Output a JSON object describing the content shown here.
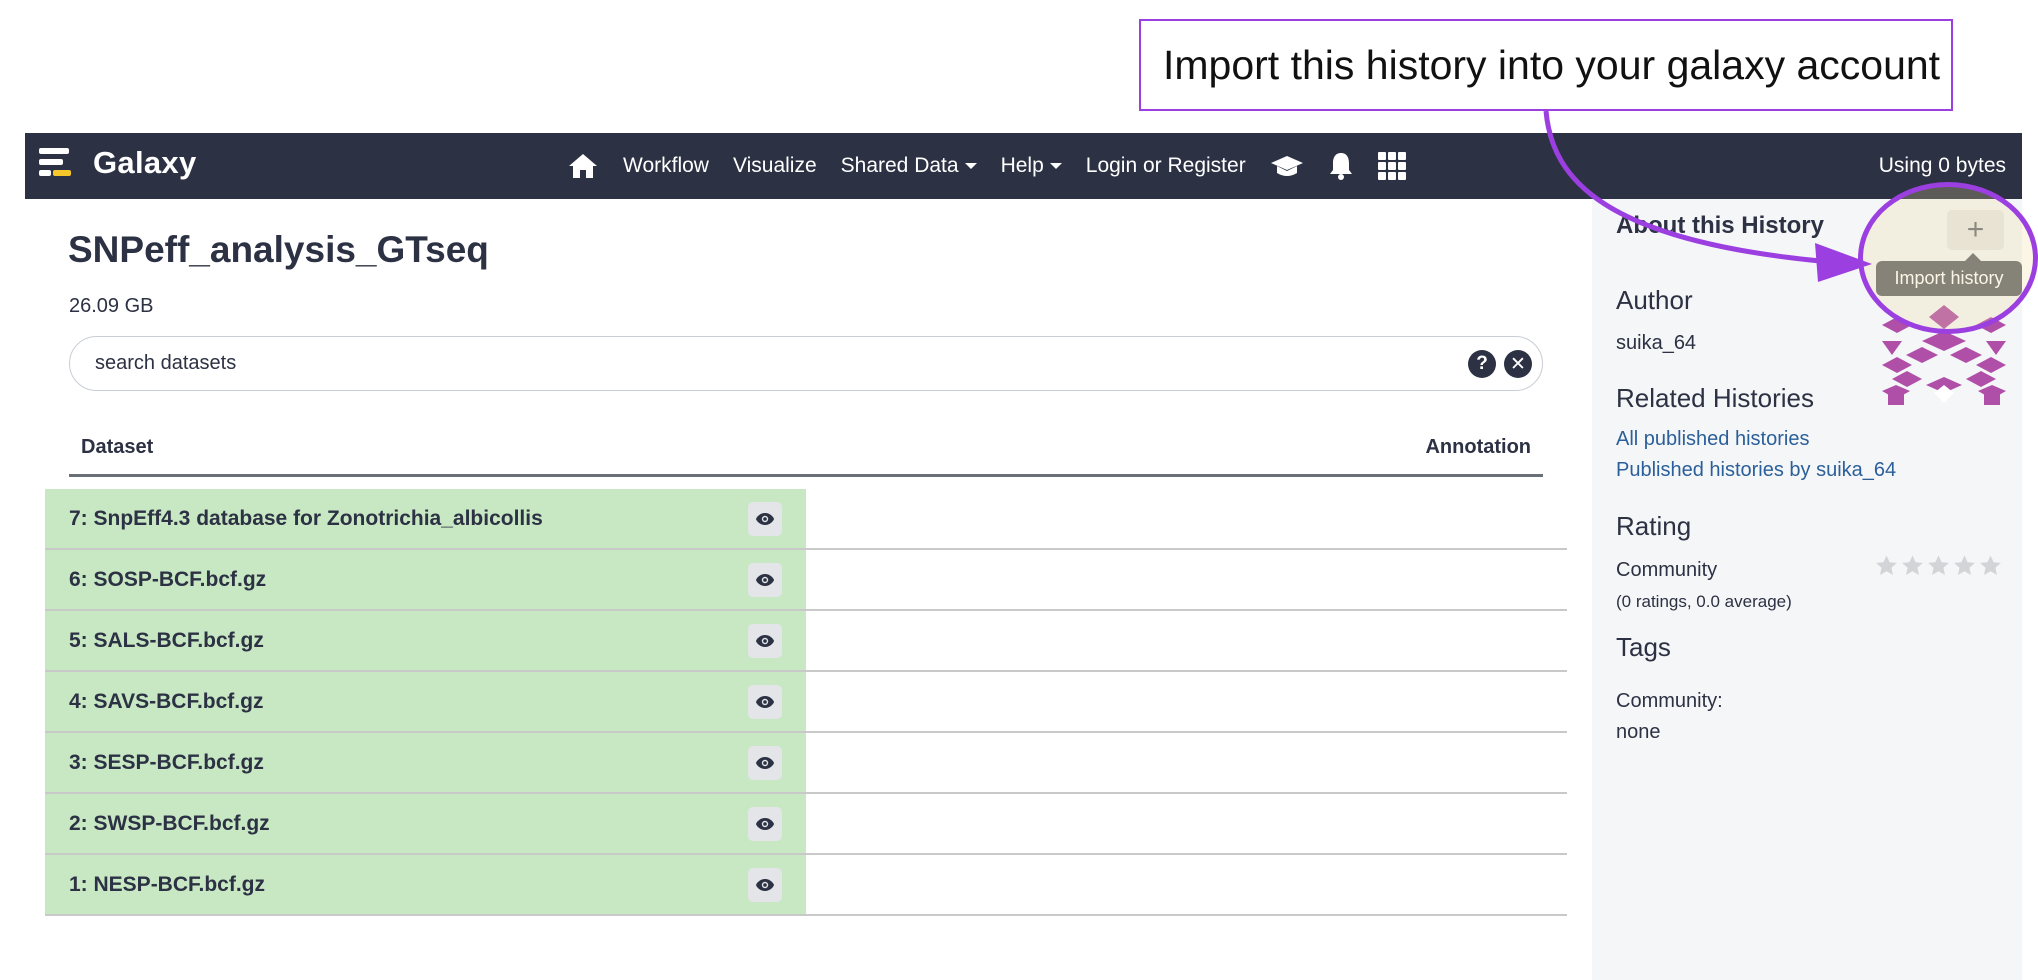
{
  "annotation": {
    "callout_text": "Import this history into your galaxy account",
    "accent_color": "#9b3fe0"
  },
  "navbar": {
    "brand": "Galaxy",
    "items": [
      {
        "label": "Workflow"
      },
      {
        "label": "Visualize"
      },
      {
        "label": "Shared Data"
      },
      {
        "label": "Help"
      },
      {
        "label": "Login or Register"
      }
    ],
    "icons": [
      "home-icon",
      "graduation-cap-icon",
      "bell-icon",
      "grid-icon"
    ],
    "usage": "Using 0 bytes",
    "background_color": "#2c3143"
  },
  "history": {
    "title": "SNPeff_analysis_GTseq",
    "size": "26.09 GB",
    "search_placeholder": "search datasets",
    "columns": {
      "dataset": "Dataset",
      "annotation": "Annotation"
    },
    "datasets": [
      {
        "name": "7: SnpEff4.3 database for Zonotrichia_albicollis",
        "annotation": ""
      },
      {
        "name": "6: SOSP-BCF.bcf.gz",
        "annotation": ""
      },
      {
        "name": "5: SALS-BCF.bcf.gz",
        "annotation": ""
      },
      {
        "name": "4: SAVS-BCF.bcf.gz",
        "annotation": ""
      },
      {
        "name": "3: SESP-BCF.bcf.gz",
        "annotation": ""
      },
      {
        "name": "2: SWSP-BCF.bcf.gz",
        "annotation": ""
      },
      {
        "name": "1: NESP-BCF.bcf.gz",
        "annotation": ""
      }
    ],
    "dataset_ok_color": "#c8e8c4"
  },
  "sidebar": {
    "about_heading": "About this History",
    "import_button": "+",
    "import_tooltip": "Import history",
    "author_heading": "Author",
    "author_name": "suika_64",
    "related_heading": "Related Histories",
    "related_links": [
      "All published histories",
      "Published histories by suika_64"
    ],
    "rating_heading": "Rating",
    "community_label": "Community",
    "rating_value": 0,
    "rating_max": 5,
    "rating_summary": "(0 ratings, 0.0 average)",
    "tags_heading": "Tags",
    "tags_label": "Community:",
    "tags_value": "none"
  }
}
